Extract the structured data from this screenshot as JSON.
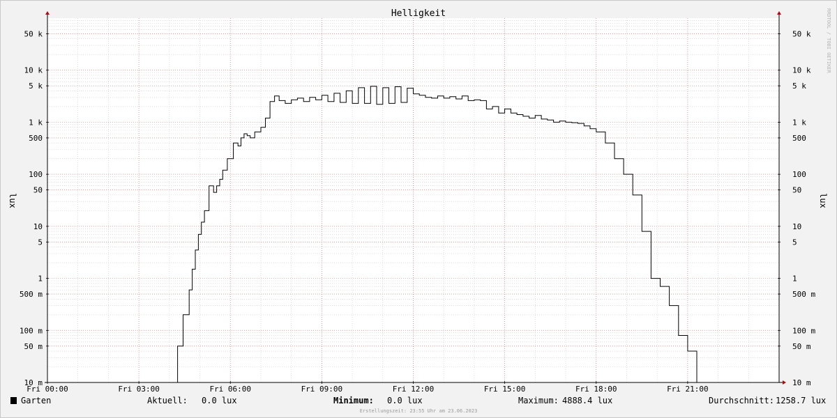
{
  "chart_data": {
    "type": "line",
    "title": "Helligkeit",
    "ylabel": "lux",
    "yscale": "log",
    "ylim": [
      0.01,
      100000
    ],
    "xlim_hours": [
      0,
      24
    ],
    "x_tick_labels": [
      "Fri 00:00",
      "Fri 03:00",
      "Fri 06:00",
      "Fri 09:00",
      "Fri 12:00",
      "Fri 15:00",
      "Fri 18:00",
      "Fri 21:00"
    ],
    "y_ticks": [
      {
        "value": 50000,
        "label": "50 k"
      },
      {
        "value": 10000,
        "label": "10 k"
      },
      {
        "value": 5000,
        "label": "5 k"
      },
      {
        "value": 1000,
        "label": "1 k"
      },
      {
        "value": 500,
        "label": "500"
      },
      {
        "value": 100,
        "label": "100"
      },
      {
        "value": 50,
        "label": "50"
      },
      {
        "value": 10,
        "label": "10"
      },
      {
        "value": 5,
        "label": "5"
      },
      {
        "value": 1,
        "label": "1"
      },
      {
        "value": 0.5,
        "label": "500 m"
      },
      {
        "value": 0.1,
        "label": "100 m"
      },
      {
        "value": 0.05,
        "label": "50 m"
      },
      {
        "value": 0.01,
        "label": "10 m"
      }
    ],
    "series": [
      {
        "name": "Garten",
        "color": "#000000",
        "x_hours": [
          0,
          4.27,
          4.45,
          4.65,
          4.75,
          4.85,
          4.95,
          5.05,
          5.15,
          5.3,
          5.45,
          5.55,
          5.65,
          5.75,
          5.9,
          6.1,
          6.25,
          6.35,
          6.45,
          6.55,
          6.65,
          6.8,
          7.0,
          7.15,
          7.3,
          7.45,
          7.6,
          7.8,
          8.0,
          8.2,
          8.4,
          8.6,
          8.8,
          9.0,
          9.2,
          9.4,
          9.6,
          9.8,
          10.0,
          10.2,
          10.4,
          10.6,
          10.8,
          11.0,
          11.2,
          11.4,
          11.6,
          11.8,
          12.0,
          12.2,
          12.4,
          12.6,
          12.8,
          13.0,
          13.2,
          13.4,
          13.6,
          13.8,
          14.0,
          14.2,
          14.4,
          14.6,
          14.8,
          15.0,
          15.2,
          15.4,
          15.6,
          15.8,
          16.0,
          16.2,
          16.4,
          16.6,
          16.8,
          17.0,
          17.2,
          17.4,
          17.6,
          17.8,
          18.0,
          18.3,
          18.6,
          18.9,
          19.2,
          19.5,
          19.8,
          20.1,
          20.4,
          20.7,
          21.0,
          21.3,
          21.5,
          21.7,
          21.9,
          22.05,
          22.2,
          22.35,
          22.45,
          22.6,
          22.75,
          22.85,
          22.95,
          23.05,
          23.15,
          23.25,
          23.35,
          23.45,
          24.0
        ],
        "y": [
          0.01,
          0.05,
          0.2,
          0.6,
          1.5,
          3.5,
          7,
          12,
          20,
          60,
          45,
          60,
          80,
          120,
          200,
          400,
          350,
          500,
          600,
          550,
          500,
          650,
          800,
          1200,
          2500,
          3200,
          2600,
          2300,
          2700,
          2900,
          2500,
          3000,
          2700,
          3300,
          2500,
          3600,
          2400,
          4000,
          2300,
          4600,
          2300,
          4900,
          2200,
          4600,
          2300,
          4800,
          2400,
          4500,
          3500,
          3300,
          3000,
          2900,
          3200,
          2900,
          3100,
          2800,
          3200,
          2600,
          2700,
          2600,
          1800,
          2000,
          1500,
          1800,
          1500,
          1400,
          1300,
          1200,
          1350,
          1150,
          1100,
          1000,
          1050,
          1000,
          980,
          950,
          850,
          750,
          650,
          400,
          200,
          100,
          40,
          8,
          1,
          0.7,
          0.3,
          0.08,
          0.04,
          0.01,
          0.01,
          0.01,
          0.01,
          0.01,
          0.01,
          0.01,
          0.01,
          0.01,
          0.01,
          0.01,
          0.01,
          0.01,
          0.01,
          0.01,
          0.01,
          0.01,
          0.01
        ]
      }
    ],
    "grid": true
  },
  "watermark": "RRDTOOL / TOBI OETIKER",
  "legend": {
    "series_name": "Garten",
    "swatch_color": "#000000",
    "current_label": "Aktuell:",
    "current_value": "0.0 lux",
    "minimum_label": "Minimum:",
    "minimum_value": "0.0 lux",
    "maximum_label": "Maximum:",
    "maximum_value": "4888.4 lux",
    "average_label": "Durchschnitt:",
    "average_value": "1258.7 lux"
  },
  "footer": "Erstellungszeit: 23:55 Uhr am 23.06.2023",
  "colors": {
    "background": "#f2f2f2",
    "plot_background": "#ffffff",
    "major_grid": "#e06060",
    "minor_grid": "#c8c8c8",
    "axis_arrow": "#a01010"
  }
}
